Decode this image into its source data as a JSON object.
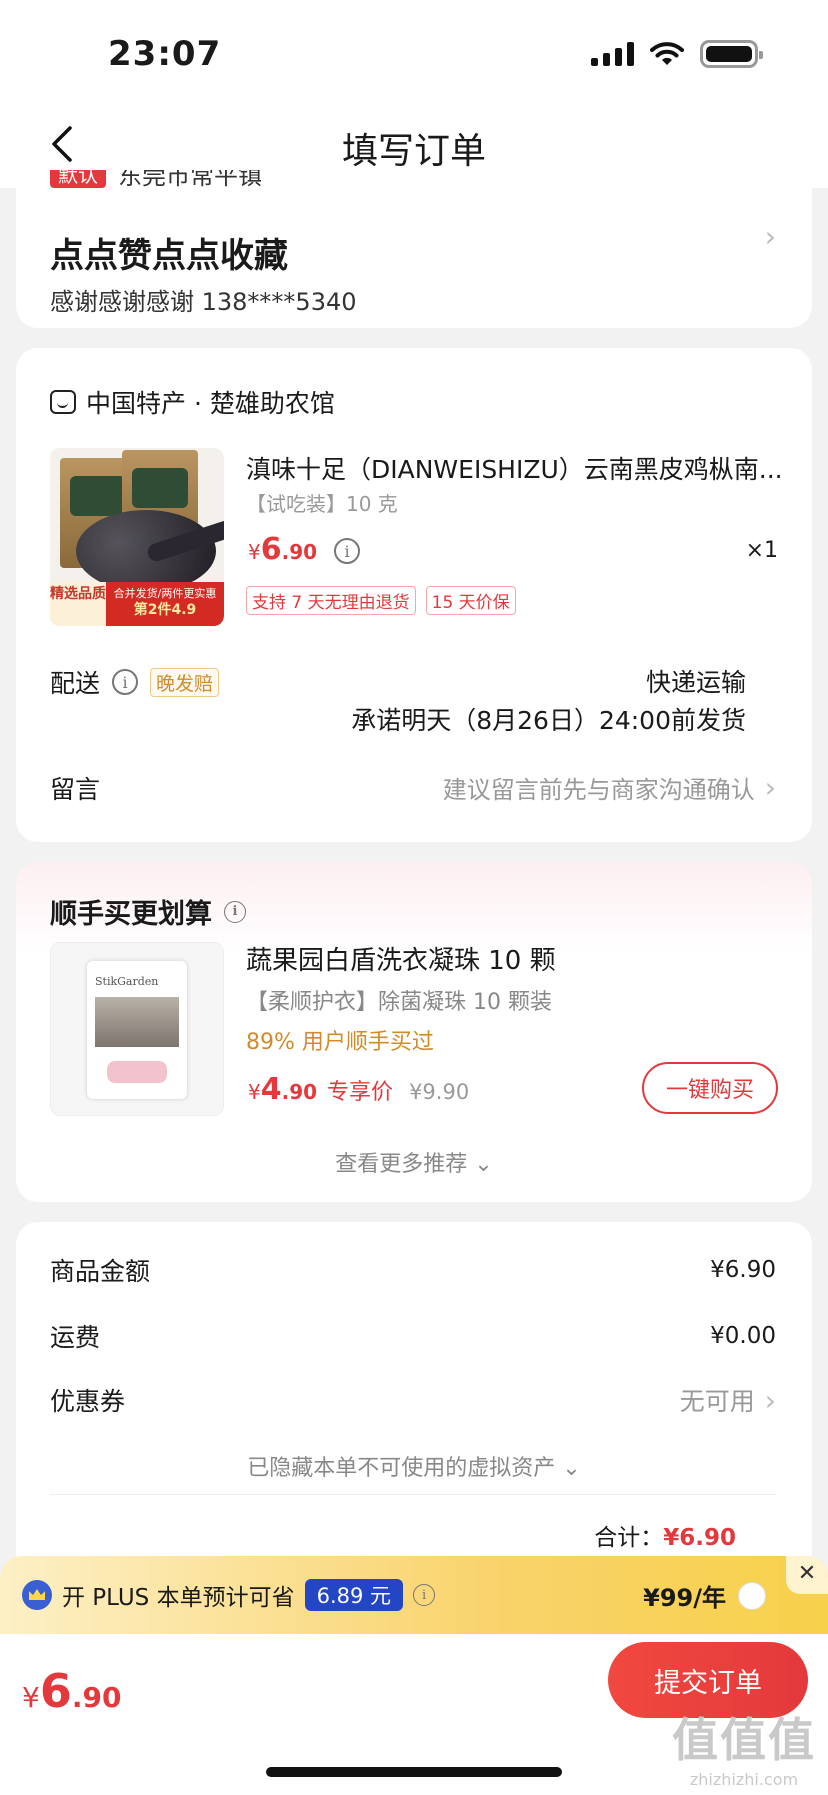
{
  "status_bar": {
    "time": "23:07"
  },
  "nav": {
    "title": "填写订单"
  },
  "address": {
    "tag": "默认",
    "region": "东莞市常平镇",
    "name": "点点赞点点收藏",
    "contact": "感谢感谢感谢  138****5340"
  },
  "order": {
    "shop_name": "中国特产 · 楚雄助农馆",
    "product": {
      "image_badges": {
        "left": "精选品质",
        "right_top": "合并发货/两件更实惠",
        "right_bottom": "第2件4.9"
      },
      "title": "滇味十足（DIANWEISHIZU）云南黑皮鸡枞南...",
      "spec": "【试吃装】10 克",
      "price_yen": "¥",
      "price_int": "6",
      "price_dec": ".90",
      "qty": "×1",
      "service_tags": [
        "支持 7 天无理由退货",
        "15 天价保"
      ]
    },
    "delivery": {
      "label": "配送",
      "late_tag": "晚发赔",
      "method": "快递运输",
      "promise": "承诺明天（8月26日）24:00前发货"
    },
    "message": {
      "label": "留言",
      "hint": "建议留言前先与商家沟通确认"
    }
  },
  "recommend": {
    "title": "顺手买更划算",
    "item": {
      "brand_on_pack": "StikGarden",
      "name": "蔬果园白盾洗衣凝珠 10 颗",
      "subtitle": "【柔顺护衣】除菌凝珠 10 颗装",
      "users": "89% 用户顺手买过",
      "price_yen": "¥",
      "price_int": "4",
      "price_dec": ".90",
      "price_label": "专享价",
      "orig_price": "¥9.90",
      "buy_label": "一键购买"
    },
    "more_label": "查看更多推荐 ⌄"
  },
  "summary": {
    "goods_label": "商品金额",
    "goods_value": "¥6.90",
    "shipping_label": "运费",
    "shipping_value": "¥0.00",
    "coupon_label": "优惠券",
    "coupon_value": "无可用",
    "hidden_assets": "已隐藏本单不可使用的虚拟资产 ⌄",
    "total_label": "合计：",
    "total_value": "¥6.90"
  },
  "plus": {
    "text_prefix": "开 PLUS 本单预计可省",
    "save_amount": "6.89 元",
    "price": "¥99/年",
    "close": "✕"
  },
  "bottom": {
    "price_yen": "¥",
    "price_int": "6",
    "price_dec": ".90",
    "submit_label": "提交订单"
  },
  "watermark": {
    "big": "值值值",
    "small": "zhizhizhi.com"
  }
}
